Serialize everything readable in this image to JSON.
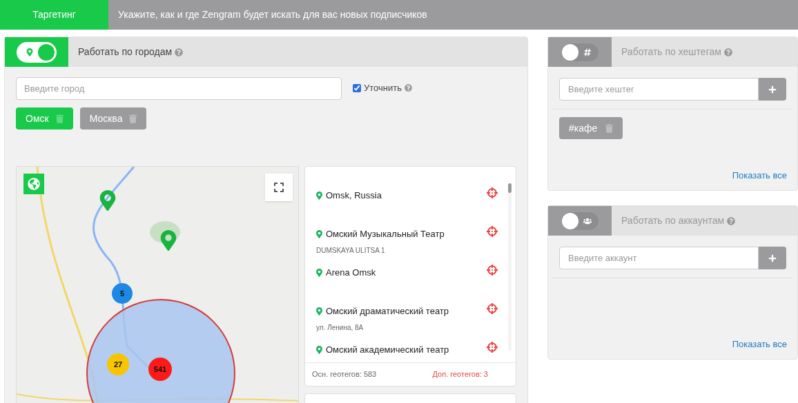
{
  "header": {
    "tab": "Таргетинг",
    "subtitle": "Укажите, как и где Zengram будет искать для вас новых подписчиков"
  },
  "cities": {
    "title": "Работать по городам",
    "on": true,
    "placeholder": "Введите город",
    "refine": {
      "label": "Уточнить",
      "checked": true
    },
    "tags": [
      {
        "label": "Омск",
        "selected": true
      },
      {
        "label": "Москва",
        "selected": false
      }
    ],
    "clusters": [
      {
        "count": "5",
        "color": "#1e88e5"
      },
      {
        "count": "27",
        "color": "#f9c400"
      },
      {
        "count": "541",
        "color": "#ff1a1a"
      }
    ],
    "places": [
      {
        "name": "Omsk, Russia"
      },
      {
        "name": "Омский Музыкальный Театр",
        "address": "DUMSKAYA ULITSA 1"
      },
      {
        "name": "Arena Omsk"
      },
      {
        "name": "Омский драматический театр",
        "address": "ул. Ленина, 8А"
      },
      {
        "name": "Омский академический театр"
      }
    ],
    "main_count": "Осн. геотегов: 583",
    "extra_count": "Доп. геотегов: 3"
  },
  "hashtags": {
    "title": "Работать по хештегам",
    "on": false,
    "placeholder": "Введите хештег",
    "tags": [
      {
        "label": "#кафе"
      }
    ],
    "show_all": "Показать все"
  },
  "accounts": {
    "title": "Работать по аккаунтам",
    "on": false,
    "placeholder": "Введите аккаунт",
    "show_all": "Показать все"
  }
}
